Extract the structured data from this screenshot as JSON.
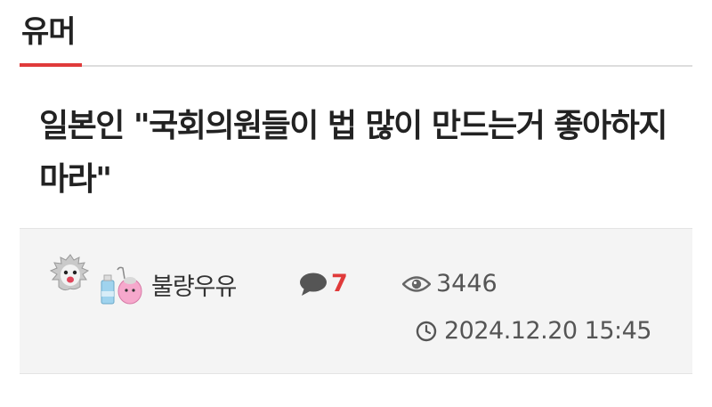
{
  "board": {
    "title": "유머"
  },
  "post": {
    "title": "일본인 \"국회의원들이 법 많이 만드는거 좋아하지 마라\"",
    "author": "불량우유",
    "comment_count": "7",
    "view_count": "3446",
    "date": "2024.12.20 15:45"
  },
  "icons": {
    "avatar": "ghost-avatar-icon",
    "level": "milk-level-icon",
    "comment": "speech-bubble-icon",
    "views": "eye-icon",
    "date": "clock-icon"
  },
  "colors": {
    "accent": "#e03a3a",
    "meta_background": "#f4f4f4",
    "text": "#222222",
    "muted": "#555555"
  }
}
